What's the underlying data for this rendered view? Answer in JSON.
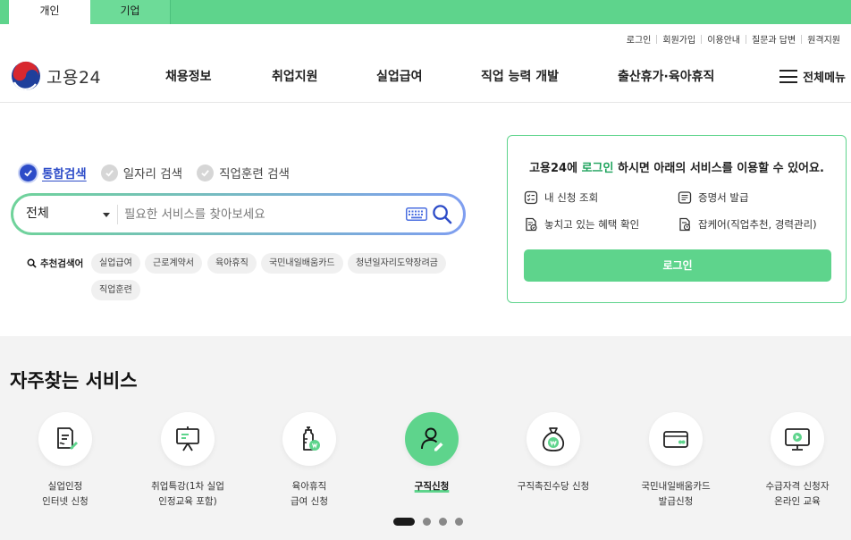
{
  "audience_tabs": [
    {
      "label": "개인",
      "active": true
    },
    {
      "label": "기업",
      "active": false
    }
  ],
  "utility_links": [
    "로그인",
    "회원가입",
    "이용안내",
    "질문과 답변",
    "원격지원"
  ],
  "header": {
    "logo_text": "고용24",
    "nav": [
      "채용정보",
      "취업지원",
      "실업급여",
      "직업 능력 개발",
      "출산휴가·육아휴직"
    ],
    "all_menu_label": "전체메뉴"
  },
  "search": {
    "scopes": [
      {
        "label": "통합검색",
        "checked": true
      },
      {
        "label": "일자리 검색",
        "checked": false
      },
      {
        "label": "직업훈련 검색",
        "checked": false
      }
    ],
    "category": "전체",
    "placeholder": "필요한 서비스를 찾아보세요",
    "recommended_label": "추천검색어",
    "keywords": [
      "실업급여",
      "근로계약서",
      "육아휴직",
      "국민내일배움카드",
      "청년일자리도약장려금",
      "직업훈련"
    ]
  },
  "login_card": {
    "title_prefix": "고용24에",
    "title_highlight": "로그인",
    "title_suffix": "하시면 아래의 서비스를 이용할 수 있어요.",
    "features": [
      "내 신청 조회",
      "증명서 발급",
      "놓치고 있는 혜택 확인",
      "잡케어(직업추천, 경력관리)"
    ],
    "button_label": "로그인"
  },
  "frequent": {
    "title": "자주찾는 서비스",
    "items": [
      {
        "label": "실업인정\n인터넷 신청",
        "icon": "document-pen-icon",
        "active": false
      },
      {
        "label": "취업특강(1차 실업\n인정교육 포함)",
        "icon": "presentation-board-icon",
        "active": false
      },
      {
        "label": "육아휴직\n급여 신청",
        "icon": "baby-bottle-icon",
        "active": false
      },
      {
        "label": "구직신청",
        "icon": "person-pen-icon",
        "active": true
      },
      {
        "label": "구직촉진수당 신청",
        "icon": "money-bag-icon",
        "active": false
      },
      {
        "label": "국민내일배움카드\n발급신청",
        "icon": "card-icon",
        "active": false
      },
      {
        "label": "수급자격 신청자\n온라인 교육",
        "icon": "monitor-play-icon",
        "active": false
      }
    ],
    "pagination": {
      "pages": 4,
      "current": 1
    }
  },
  "colors": {
    "brand_green": "#5ed48c",
    "accent_blue": "#2d4cc8"
  }
}
